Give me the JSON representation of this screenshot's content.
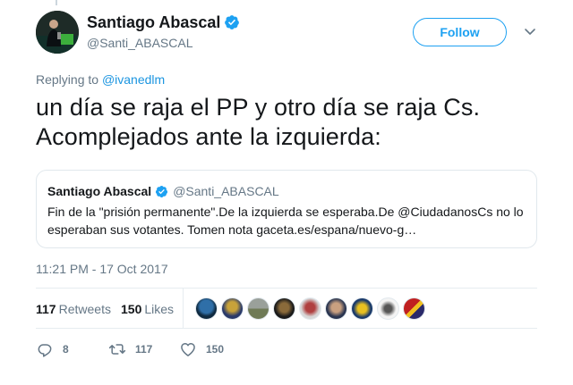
{
  "author": {
    "display_name": "Santiago Abascal",
    "handle": "@Santi_ABASCAL",
    "verified": true
  },
  "follow_label": "Follow",
  "replying": {
    "prefix": "Replying to",
    "mention": "@ivanedlm"
  },
  "tweet_text": "un día se raja el PP y otro día se raja Cs. Acomplejados ante la izquierda:",
  "quote": {
    "display_name": "Santiago Abascal",
    "handle": "@Santi_ABASCAL",
    "text": "Fin de la \"prisión permanente\".De la izquierda se esperaba.De @CiudadanosCs no lo esperaban sus votantes. Tomen nota gaceta.es/espana/nuevo-g…"
  },
  "timestamp": "11:21 PM - 17 Oct 2017",
  "stats": {
    "retweets_count": "117",
    "retweets_label": "Retweets",
    "likes_count": "150",
    "likes_label": "Likes"
  },
  "actions": {
    "reply_count": "8",
    "retweet_count": "117",
    "like_count": "150"
  },
  "colors": {
    "accent": "#1da1f2",
    "secondary_text": "#657786",
    "primary_text": "#14171a",
    "border": "#e1e8ed"
  },
  "icons": [
    "verified-badge-icon",
    "chevron-down-icon",
    "reply-icon",
    "retweet-icon",
    "heart-icon"
  ]
}
